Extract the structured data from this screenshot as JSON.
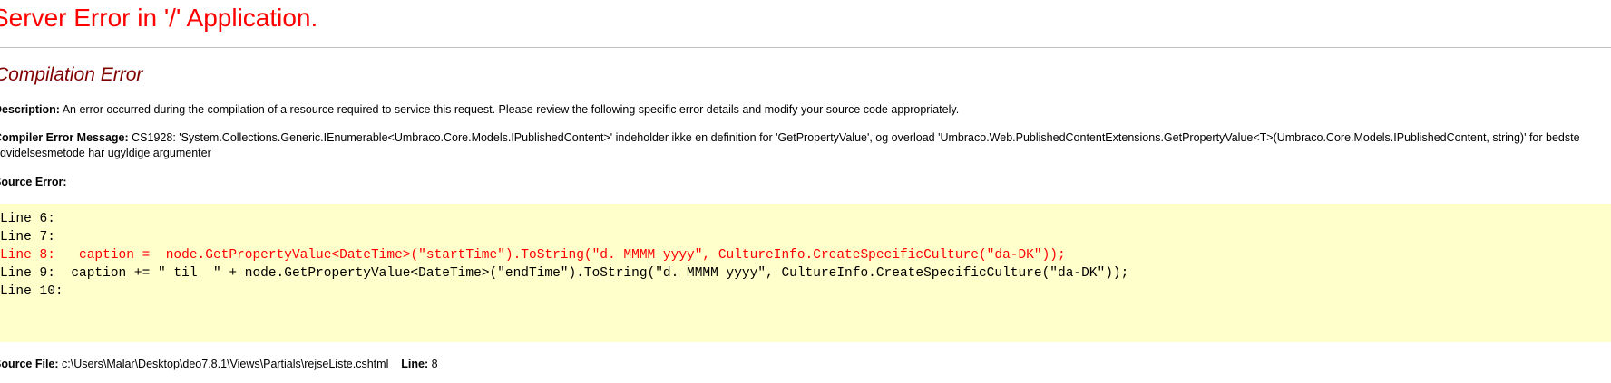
{
  "header": {
    "title": "Server Error in '/' Application."
  },
  "error": {
    "type_title": "Compilation Error",
    "description_label": "Description:",
    "description_text": " An error occurred during the compilation of a resource required to service this request. Please review the following specific error details and modify your source code appropriately.",
    "compiler_label": "Compiler Error Message:",
    "compiler_text_line1": " CS1928: 'System.Collections.Generic.IEnumerable<Umbraco.Core.Models.IPublishedContent>' indeholder ikke en definition for 'GetPropertyValue', og overload 'Umbraco.Web.PublishedContentExtensions.GetPropertyValue<T>(Umbraco.Core.Models.IPublishedContent, string)' for bedste",
    "compiler_text_line2": "udvidelsesmetode har ugyldige argumenter",
    "source_error_label": "Source Error:",
    "source_lines": [
      {
        "text": "Line 6:",
        "highlight": false
      },
      {
        "text": "Line 7:",
        "highlight": false
      },
      {
        "text": "Line 8:   caption =  node.GetPropertyValue<DateTime>(\"startTime\").ToString(\"d. MMMM yyyy\", CultureInfo.CreateSpecificCulture(\"da-DK\"));",
        "highlight": true
      },
      {
        "text": "Line 9:  caption += \" til  \" + node.GetPropertyValue<DateTime>(\"endTime\").ToString(\"d. MMMM yyyy\", CultureInfo.CreateSpecificCulture(\"da-DK\"));",
        "highlight": false
      },
      {
        "text": "Line 10:",
        "highlight": false
      }
    ],
    "source_file_label": "Source File:",
    "source_file_value": " c:\\Users\\Malar\\Desktop\\deo7.8.1\\Views\\Partials\\rejseListe.cshtml",
    "line_label": "Line:",
    "line_value": " 8"
  },
  "colors": {
    "title": "#ff0000",
    "subtitle": "#800000",
    "code_background": "#ffffcc",
    "highlight_line": "#ff0000"
  }
}
